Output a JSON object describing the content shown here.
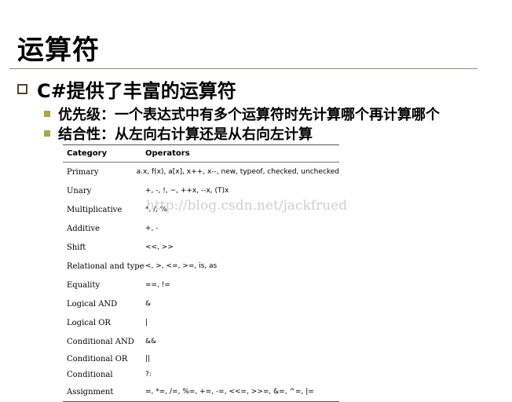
{
  "slide": {
    "title": "运算符",
    "bullet": "C#提供了丰富的运算符",
    "subbullets": [
      "优先级：一个表达式中有多个运算符时先计算哪个再计算哪个",
      "结合性：从左向右计算还是从右向左计算"
    ]
  },
  "table": {
    "headers": [
      "Category",
      "Operators"
    ],
    "rows": [
      {
        "category": "Primary",
        "operators": "a.x, f(x), a[x], x++, x--, new, typeof, checked, unchecked"
      },
      {
        "category": "Unary",
        "operators": "+, -, !, ~, ++x, --x, (T)x"
      },
      {
        "category": "Multiplicative",
        "operators": "*, /, %"
      },
      {
        "category": "Additive",
        "operators": "+, -"
      },
      {
        "category": "Shift",
        "operators": "<<, >>"
      },
      {
        "category": "Relational and type",
        "operators": "<, >, <=, >=, is, as"
      },
      {
        "category": "Equality",
        "operators": "==, !="
      },
      {
        "category": "Logical AND",
        "operators": "&"
      },
      {
        "category": "Logical OR",
        "operators": "|"
      },
      {
        "category": "Conditional AND",
        "operators": "&&"
      },
      {
        "category": "Conditional OR",
        "operators": "||"
      },
      {
        "category": "Conditional",
        "operators": "?:"
      },
      {
        "category": "Assignment",
        "operators": "=, *=, /=, %=, +=, -=, <<=, >>=, &=, ^=, |="
      }
    ]
  },
  "watermark": "http://blog.csdn.net/jackfrued",
  "colors": {
    "rule": "#8d8d73",
    "bullet_fill": "#a8a84a",
    "bullet_outline": "#4a4a2f"
  }
}
